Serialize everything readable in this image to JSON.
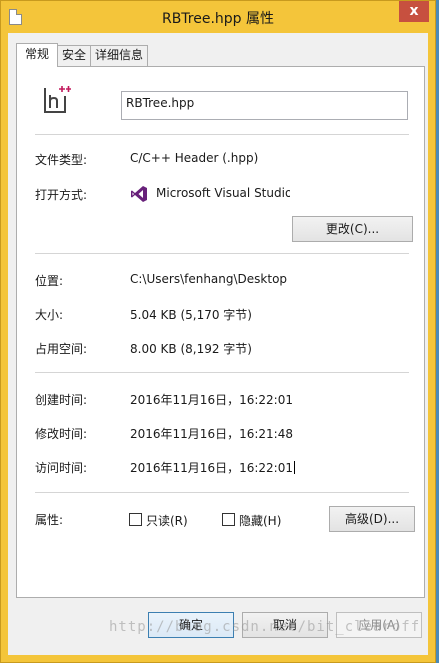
{
  "window": {
    "title": "RBTree.hpp 属性",
    "close_glyph": "x"
  },
  "tabs": [
    {
      "label": "常规",
      "active": true
    },
    {
      "label": "安全",
      "active": false
    },
    {
      "label": "详细信息",
      "active": false
    }
  ],
  "general": {
    "file_name": "RBTree.hpp",
    "file_type_label": "文件类型:",
    "file_type_value": "C/C++ Header (.hpp)",
    "open_with_label": "打开方式:",
    "open_with_value": "Microsoft Visual Studio",
    "change_button": "更改(C)...",
    "location_label": "位置:",
    "location_value": "C:\\Users\\fenhang\\Desktop",
    "size_label": "大小:",
    "size_value": "5.04 KB (5,170 字节)",
    "disk_size_label": "占用空间:",
    "disk_size_value": "8.00 KB (8,192 字节)",
    "created_label": "创建时间:",
    "created_value": "2016年11月16日，16:22:01",
    "modified_label": "修改时间:",
    "modified_value": "2016年11月16日，16:21:48",
    "accessed_label": "访问时间:",
    "accessed_value": "2016年11月16日，16:22:01",
    "attributes_label": "属性:",
    "readonly_label": "只读(R)",
    "hidden_label": "隐藏(H)",
    "advanced_button": "高级(D)...",
    "readonly_checked": false,
    "hidden_checked": false
  },
  "footer": {
    "ok_button": "确定",
    "cancel_button": "取消",
    "apply_button": "应用(A)"
  },
  "watermark": "http://blog.csdn.net/bit_clearoff",
  "colors": {
    "titlebar": "#f4c53a",
    "close": "#c7503f",
    "vs_purple": "#68217a",
    "file_icon_pink": "#c2185b"
  }
}
